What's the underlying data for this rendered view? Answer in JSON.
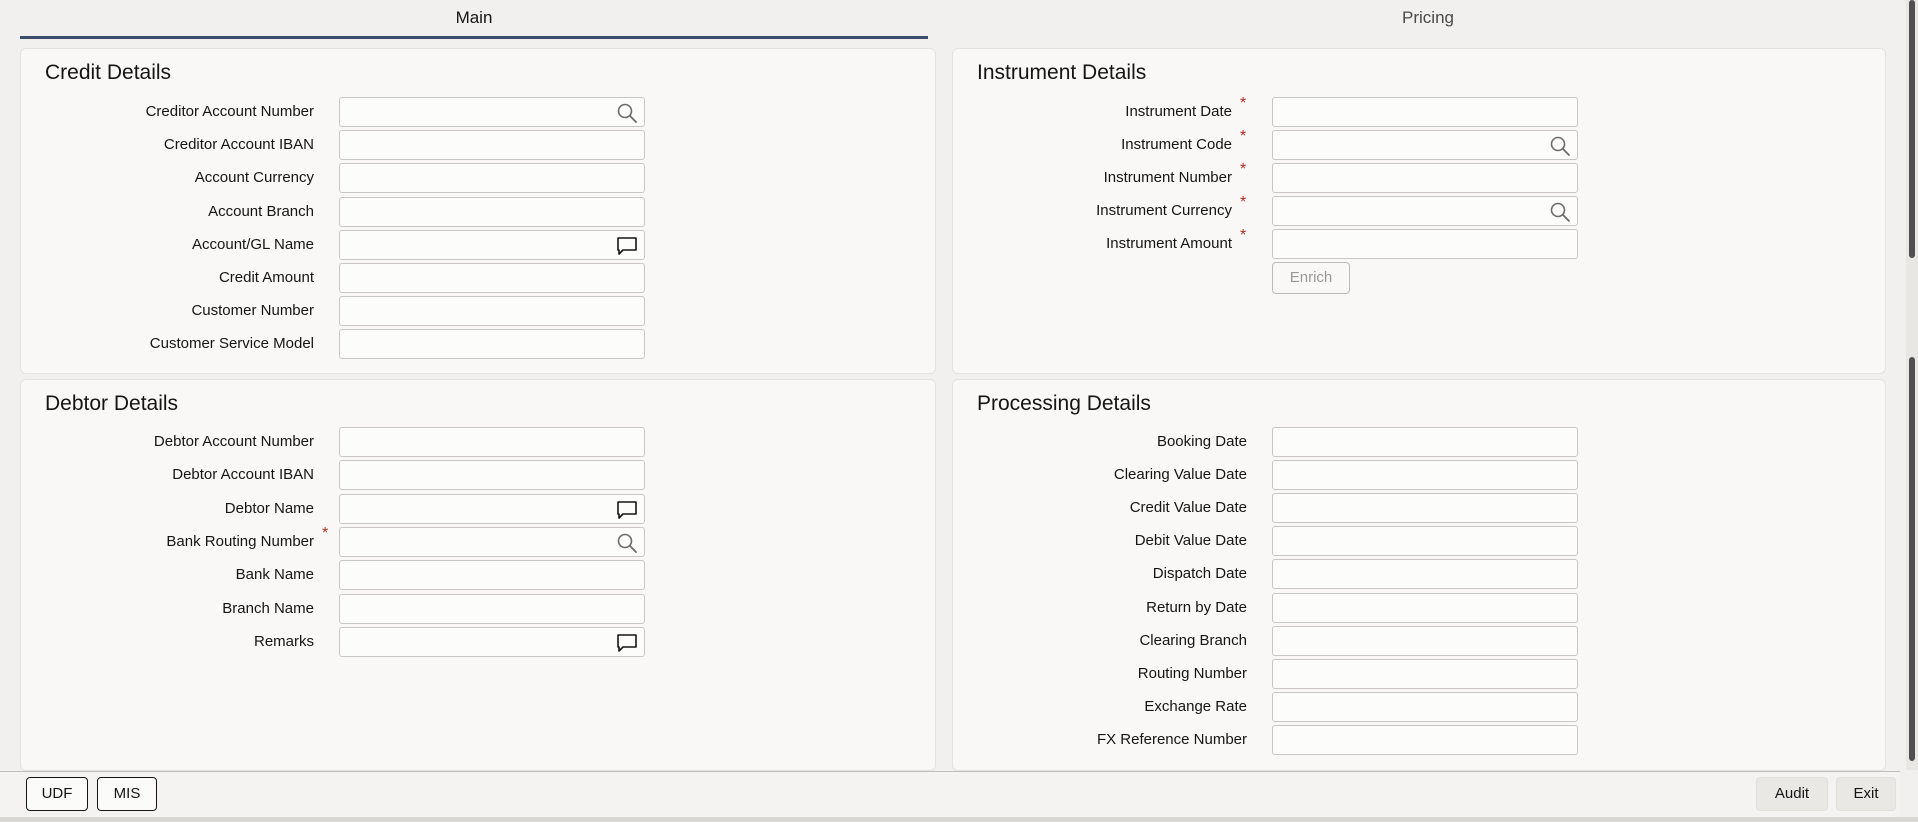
{
  "tabs": [
    {
      "label": "Main",
      "active": true
    },
    {
      "label": "Pricing",
      "active": false
    }
  ],
  "credit_details": {
    "title": "Credit Details",
    "fields": [
      {
        "label": "Creditor Account Number",
        "value": "",
        "icon": "search-icon",
        "required": false
      },
      {
        "label": "Creditor Account IBAN",
        "value": "",
        "icon": "",
        "required": false
      },
      {
        "label": "Account Currency",
        "value": "",
        "icon": "",
        "required": false
      },
      {
        "label": "Account Branch",
        "value": "",
        "icon": "",
        "required": false
      },
      {
        "label": "Account/GL Name",
        "value": "",
        "icon": "comment-icon",
        "required": false
      },
      {
        "label": "Credit Amount",
        "value": "",
        "icon": "",
        "required": false
      },
      {
        "label": "Customer Number",
        "value": "",
        "icon": "",
        "required": false
      },
      {
        "label": "Customer Service Model",
        "value": "",
        "icon": "",
        "required": false
      }
    ]
  },
  "instrument_details": {
    "title": "Instrument Details",
    "fields": [
      {
        "label": "Instrument Date",
        "value": "",
        "icon": "",
        "required": true
      },
      {
        "label": "Instrument Code",
        "value": "",
        "icon": "search-icon",
        "required": true
      },
      {
        "label": "Instrument Number",
        "value": "",
        "icon": "",
        "required": true
      },
      {
        "label": "Instrument Currency",
        "value": "",
        "icon": "search-icon",
        "required": true
      },
      {
        "label": "Instrument Amount",
        "value": "",
        "icon": "",
        "required": true
      }
    ],
    "enrich_label": "Enrich"
  },
  "debtor_details": {
    "title": "Debtor Details",
    "fields": [
      {
        "label": "Debtor Account Number",
        "value": "",
        "icon": "",
        "required": false
      },
      {
        "label": "Debtor Account IBAN",
        "value": "",
        "icon": "",
        "required": false
      },
      {
        "label": "Debtor Name",
        "value": "",
        "icon": "comment-icon",
        "required": false
      },
      {
        "label": "Bank Routing Number",
        "value": "",
        "icon": "search-icon",
        "required": true
      },
      {
        "label": "Bank Name",
        "value": "",
        "icon": "",
        "required": false
      },
      {
        "label": "Branch Name",
        "value": "",
        "icon": "",
        "required": false
      },
      {
        "label": "Remarks",
        "value": "",
        "icon": "comment-icon",
        "required": false
      }
    ]
  },
  "processing_details": {
    "title": "Processing Details",
    "fields": [
      {
        "label": "Booking Date",
        "value": ""
      },
      {
        "label": "Clearing Value Date",
        "value": ""
      },
      {
        "label": "Credit Value Date",
        "value": ""
      },
      {
        "label": "Debit Value Date",
        "value": ""
      },
      {
        "label": "Dispatch Date",
        "value": ""
      },
      {
        "label": "Return by Date",
        "value": ""
      },
      {
        "label": "Clearing Branch",
        "value": ""
      },
      {
        "label": "Routing Number",
        "value": ""
      },
      {
        "label": "Exchange Rate",
        "value": ""
      },
      {
        "label": "FX Reference Number",
        "value": ""
      }
    ]
  },
  "footer": {
    "udf_label": "UDF",
    "mis_label": "MIS",
    "audit_label": "Audit",
    "exit_label": "Exit"
  },
  "colors": {
    "required": "#b5291f",
    "active_tab_underline": "#3c4e6e"
  }
}
